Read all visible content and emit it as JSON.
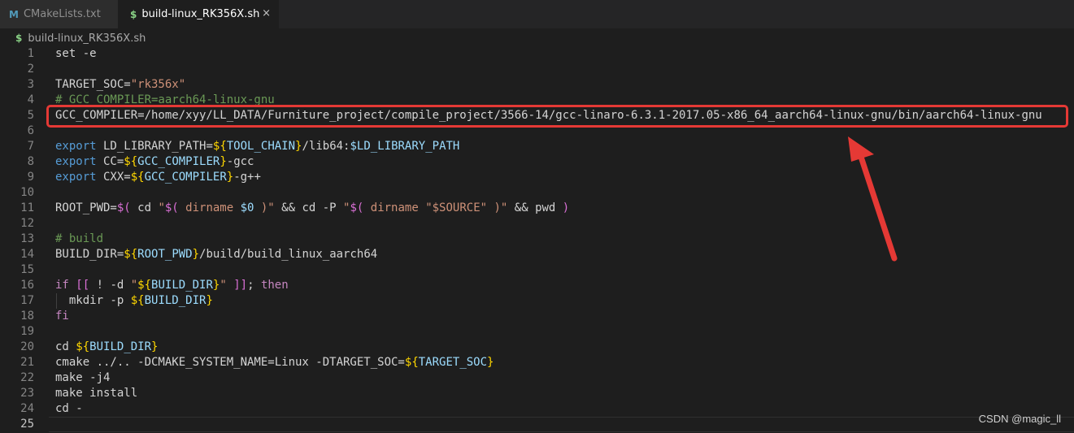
{
  "tabs": [
    {
      "label": "CMakeLists.txt",
      "icon": "M"
    },
    {
      "label": "build-linux_RK356X.sh",
      "icon": "$",
      "close": "×"
    }
  ],
  "breadcrumb": {
    "icon": "$",
    "label": "build-linux_RK356X.sh"
  },
  "editor": {
    "active_line": 25,
    "lines": [
      {
        "n": "1",
        "tokens": [
          [
            "set -e",
            "d"
          ]
        ]
      },
      {
        "n": "2",
        "tokens": []
      },
      {
        "n": "3",
        "tokens": [
          [
            "TARGET_SOC=",
            "d"
          ],
          [
            "\"rk356x\"",
            "s"
          ]
        ]
      },
      {
        "n": "4",
        "tokens": [
          [
            "# GCC_COMPILER=aarch64-linux-gnu",
            "c"
          ]
        ]
      },
      {
        "n": "5",
        "tokens": [
          [
            "GCC_COMPILER=/home/xyy/LL_DATA/Furniture_project/compile_project/3566-14/gcc-linaro-6.3.1-2017.05-x86_64_aarch64-linux-gnu/bin/aarch64-linux-gnu",
            "d"
          ]
        ]
      },
      {
        "n": "6",
        "tokens": []
      },
      {
        "n": "7",
        "tokens": [
          [
            "export",
            "k"
          ],
          [
            " LD_LIBRARY_PATH=",
            "d"
          ],
          [
            "$",
            "y"
          ],
          [
            "{",
            "y"
          ],
          [
            "TOOL_CHAIN",
            "v"
          ],
          [
            "}",
            "y"
          ],
          [
            "/lib64:",
            "d"
          ],
          [
            "$LD_LIBRARY_PATH",
            "v"
          ]
        ]
      },
      {
        "n": "8",
        "tokens": [
          [
            "export",
            "k"
          ],
          [
            " CC=",
            "d"
          ],
          [
            "$",
            "y"
          ],
          [
            "{",
            "y"
          ],
          [
            "GCC_COMPILER",
            "v"
          ],
          [
            "}",
            "y"
          ],
          [
            "-gcc",
            "d"
          ]
        ]
      },
      {
        "n": "9",
        "tokens": [
          [
            "export",
            "k"
          ],
          [
            " CXX=",
            "d"
          ],
          [
            "$",
            "y"
          ],
          [
            "{",
            "y"
          ],
          [
            "GCC_COMPILER",
            "v"
          ],
          [
            "}",
            "y"
          ],
          [
            "-g++",
            "d"
          ]
        ]
      },
      {
        "n": "10",
        "tokens": []
      },
      {
        "n": "11",
        "tokens": [
          [
            "ROOT_PWD=",
            "d"
          ],
          [
            "$(",
            "p"
          ],
          [
            " cd ",
            "d"
          ],
          [
            "\"",
            "s"
          ],
          [
            "$(",
            "p"
          ],
          [
            " dirname ",
            "s"
          ],
          [
            "$0",
            "v"
          ],
          [
            " )\"",
            "s"
          ],
          [
            " && cd -P ",
            "d"
          ],
          [
            "\"",
            "s"
          ],
          [
            "$(",
            "p"
          ],
          [
            " dirname ",
            "s"
          ],
          [
            "\"$SOURCE\"",
            "s"
          ],
          [
            " )\"",
            "s"
          ],
          [
            " && pwd ",
            "d"
          ],
          [
            ")",
            "p"
          ]
        ]
      },
      {
        "n": "12",
        "tokens": []
      },
      {
        "n": "13",
        "tokens": [
          [
            "# build",
            "c"
          ]
        ]
      },
      {
        "n": "14",
        "tokens": [
          [
            "BUILD_DIR=",
            "d"
          ],
          [
            "$",
            "y"
          ],
          [
            "{",
            "y"
          ],
          [
            "ROOT_PWD",
            "v"
          ],
          [
            "}",
            "y"
          ],
          [
            "/build/build_linux_aarch64",
            "d"
          ]
        ]
      },
      {
        "n": "15",
        "tokens": []
      },
      {
        "n": "16",
        "tokens": [
          [
            "if",
            "kw"
          ],
          [
            " ",
            "d"
          ],
          [
            "[[",
            "p"
          ],
          [
            " ! -d ",
            "d"
          ],
          [
            "\"",
            "s"
          ],
          [
            "$",
            "y"
          ],
          [
            "{",
            "y"
          ],
          [
            "BUILD_DIR",
            "v"
          ],
          [
            "}",
            "y"
          ],
          [
            "\"",
            "s"
          ],
          [
            " ",
            "d"
          ],
          [
            "]]",
            "p"
          ],
          [
            "; ",
            "d"
          ],
          [
            "then",
            "kw"
          ]
        ]
      },
      {
        "n": "17",
        "tokens": [
          [
            "  mkdir -p ",
            "d"
          ],
          [
            "$",
            "y"
          ],
          [
            "{",
            "y"
          ],
          [
            "BUILD_DIR",
            "v"
          ],
          [
            "}",
            "y"
          ]
        ]
      },
      {
        "n": "18",
        "tokens": [
          [
            "fi",
            "kw"
          ]
        ]
      },
      {
        "n": "19",
        "tokens": []
      },
      {
        "n": "20",
        "tokens": [
          [
            "cd ",
            "d"
          ],
          [
            "$",
            "y"
          ],
          [
            "{",
            "y"
          ],
          [
            "BUILD_DIR",
            "v"
          ],
          [
            "}",
            "y"
          ]
        ]
      },
      {
        "n": "21",
        "tokens": [
          [
            "cmake ../.. -DCMAKE_SYSTEM_NAME=Linux -DTARGET_SOC=",
            "d"
          ],
          [
            "$",
            "y"
          ],
          [
            "{",
            "y"
          ],
          [
            "TARGET_SOC",
            "v"
          ],
          [
            "}",
            "y"
          ]
        ]
      },
      {
        "n": "22",
        "tokens": [
          [
            "make -j4",
            "d"
          ]
        ]
      },
      {
        "n": "23",
        "tokens": [
          [
            "make install",
            "d"
          ]
        ]
      },
      {
        "n": "24",
        "tokens": [
          [
            "cd -",
            "d"
          ]
        ]
      },
      {
        "n": "25",
        "tokens": []
      }
    ]
  },
  "annotation": {
    "color": "#e53935"
  },
  "watermark": "CSDN @magic_ll",
  "colors": {
    "background": "#1e1e1e",
    "keyword": "#569cd6",
    "string": "#ce9178",
    "variable": "#9cdcfe",
    "comment": "#6a9955",
    "control": "#c586c0"
  }
}
